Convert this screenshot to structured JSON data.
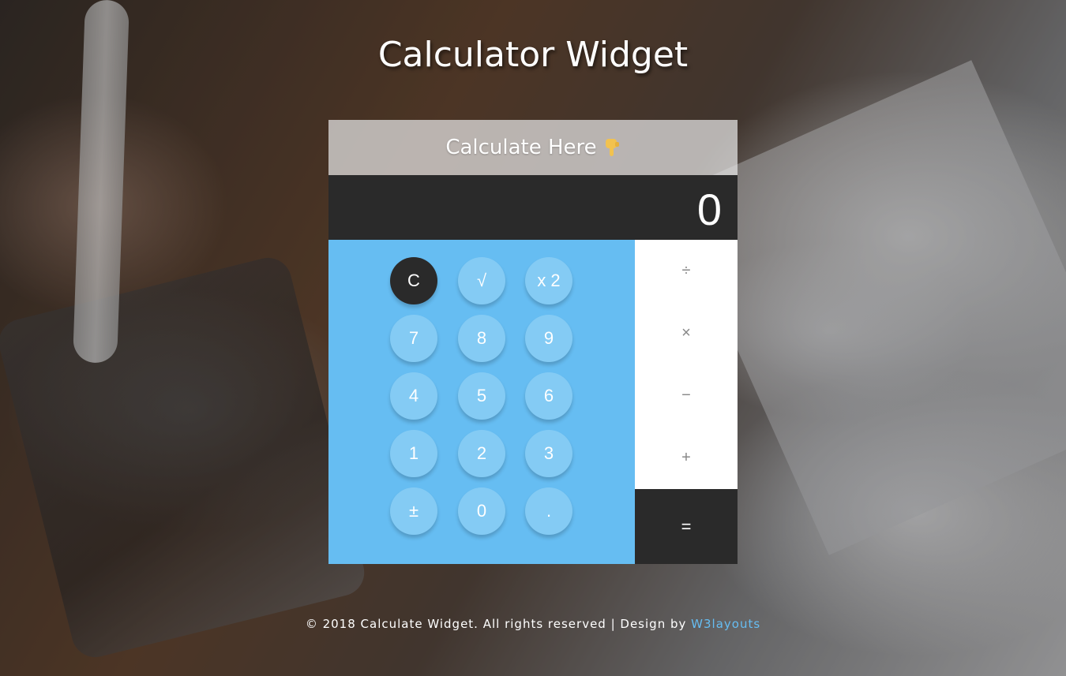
{
  "page": {
    "title": "Calculator Widget"
  },
  "widget": {
    "header": "Calculate Here",
    "header_icon": "pointing-down-hand-icon",
    "display_value": "0"
  },
  "keys": {
    "clear": "C",
    "sqrt": "√",
    "square": "x 2",
    "seven": "7",
    "eight": "8",
    "nine": "9",
    "four": "4",
    "five": "5",
    "six": "6",
    "one": "1",
    "two": "2",
    "three": "3",
    "plus_minus": "±",
    "zero": "0",
    "decimal": "."
  },
  "operators": {
    "divide": "÷",
    "multiply": "×",
    "subtract": "−",
    "add": "+",
    "equals": "="
  },
  "footer": {
    "text": "© 2018 Calculate Widget. All rights reserved | Design by",
    "link": "W3layouts"
  },
  "colors": {
    "keypad": "#66bdf2",
    "key": "#84cbf4",
    "dark": "#2a2a2a",
    "link": "#66bdf2"
  }
}
